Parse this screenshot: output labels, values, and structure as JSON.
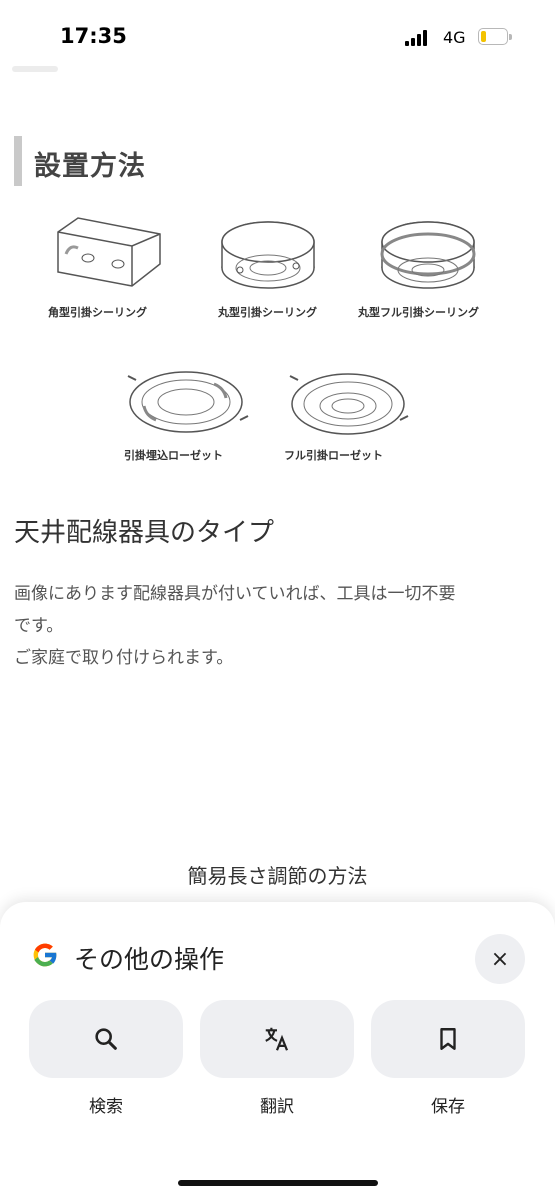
{
  "status_bar": {
    "time": "17:35",
    "network": "4G"
  },
  "section": {
    "title": "設置方法"
  },
  "fixtures": [
    {
      "label": "角型引掛シーリング"
    },
    {
      "label": "丸型引掛シーリング"
    },
    {
      "label": "丸型フル引掛シーリング"
    },
    {
      "label": "引掛埋込ローゼット"
    },
    {
      "label": "フル引掛ローゼット"
    }
  ],
  "description": {
    "heading": "天井配線器具のタイプ",
    "lines": [
      "画像にあります配線器具が付いていれば、工具は一切不要",
      "です。",
      "ご家庭で取り付けられます。"
    ]
  },
  "sub_heading": "簡易長さ調節の方法",
  "sheet": {
    "title": "その他の操作",
    "close": "×",
    "actions": [
      {
        "label": "検索",
        "icon": "search-icon"
      },
      {
        "label": "翻訳",
        "icon": "translate-icon"
      },
      {
        "label": "保存",
        "icon": "bookmark-icon"
      }
    ]
  }
}
